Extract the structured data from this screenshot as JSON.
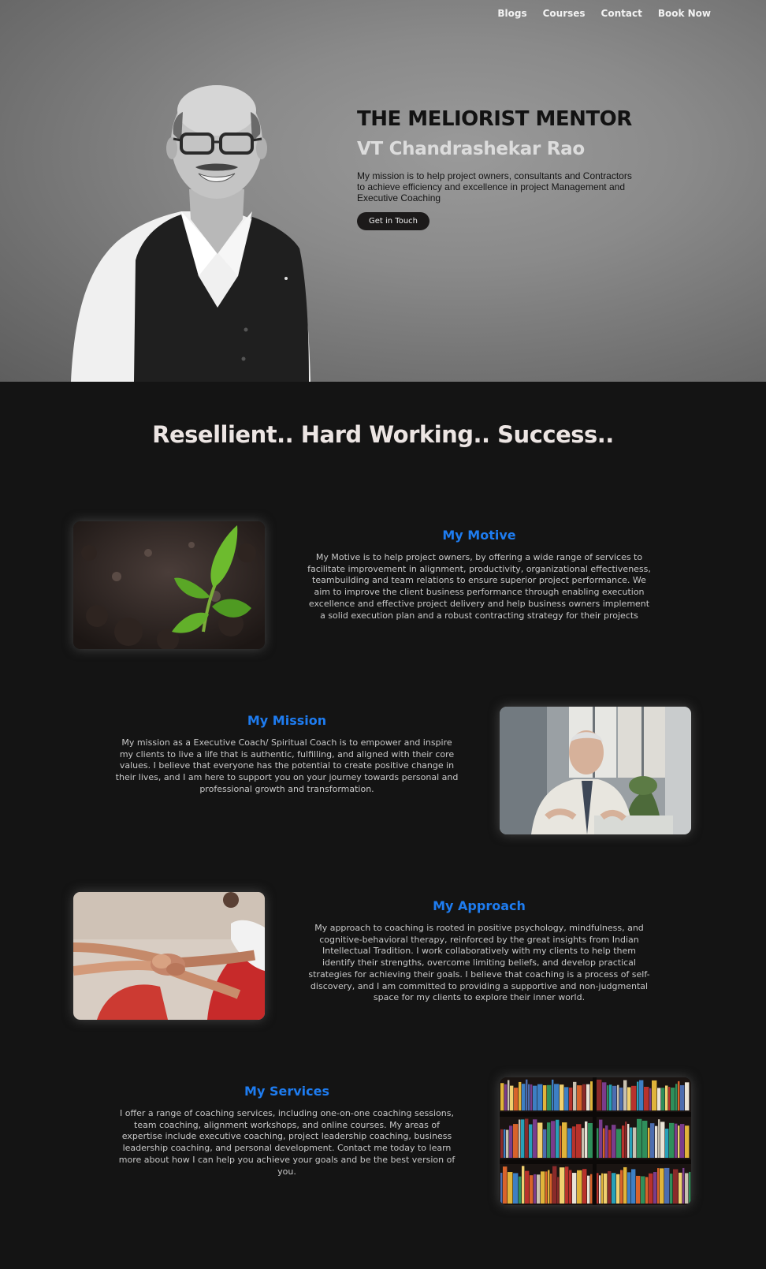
{
  "nav": {
    "items": [
      "Blogs",
      "Courses",
      "Contact",
      "Book Now"
    ]
  },
  "hero": {
    "title": "THE MELIORIST MENTOR",
    "name": "VT Chandrashekar Rao",
    "description": "My mission is to help project owners, consultants and Contractors to achieve efficiency and excellence in project Management and Executive Coaching",
    "cta_label": "Get in Touch"
  },
  "tagline": "Resellient.. Hard Working.. Success..",
  "sections": [
    {
      "heading": "My Motive",
      "body": "My Motive is to help project owners, by offering a wide range of services to facilitate improvement in alignment, productivity, organizational effectiveness, teambuilding and team relations to ensure superior project performance. We aim to improve the client business performance through enabling execution excellence and effective project delivery and help business owners implement a solid execution plan and a robust contracting strategy for their projects"
    },
    {
      "heading": "My Mission",
      "body": "My mission as a Executive Coach/ Spiritual Coach is to empower and inspire my clients to live a life that is authentic, fulfilling, and aligned with their core values. I believe that everyone has the potential to create positive change in their lives, and I am here to support you on your journey towards personal and professional growth and transformation."
    },
    {
      "heading": "My Approach",
      "body": "My approach to coaching is rooted in positive psychology, mindfulness, and cognitive-behavioral therapy, reinforced by the great insights from Indian Intellectual Tradition. I work collaboratively with my clients to help them identify their strengths, overcome limiting beliefs, and develop practical strategies for achieving their goals. I believe that coaching is a process of self-discovery, and I am committed to providing a supportive and non-judgmental space for my clients to explore their inner world."
    },
    {
      "heading": "My Services",
      "body": "I offer a range of coaching services, including one-on-one coaching sessions, team coaching, alignment workshops, and online courses. My areas of expertise include executive coaching, project leadership coaching, business leadership coaching, and personal development. Contact me today to learn more about how I can help you achieve your goals and be the best version of you."
    }
  ],
  "colors": {
    "background": "#141414",
    "heading_accent": "#1e7cf0",
    "body_text": "#c8c8c8"
  }
}
